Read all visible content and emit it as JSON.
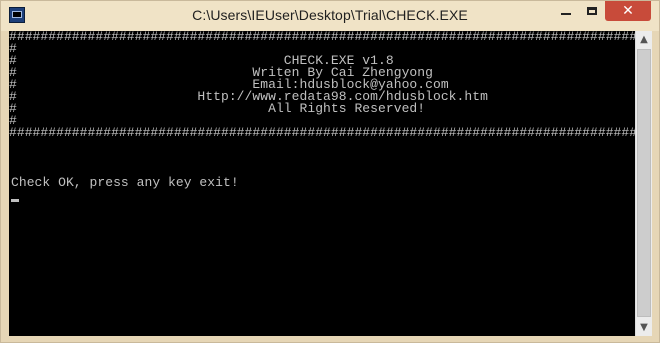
{
  "window": {
    "title": "C:\\Users\\IEUser\\Desktop\\Trial\\CHECK.EXE",
    "controls": {
      "minimize_icon": "minimize-icon",
      "maximize_icon": "maximize-icon",
      "close_label": "✕"
    }
  },
  "console": {
    "banner_lines": [
      "######################################################################################",
      "#                                                                                    #",
      "#                                  CHECK.EXE v1.8                                    #",
      "#                              Writen By Cai Zhengyong                               #",
      "#                              Email:hdusblock@yahoo.com                             #",
      "#                       Http://www.redata98.com/hdusblock.htm                        #",
      "#                                All Rights Reserved!                                #",
      "#                                                                                    #",
      "######################################################################################"
    ],
    "status_line": "Check OK, press any key exit!"
  },
  "colors": {
    "titlebar_bg": "#f0e3c6",
    "close_btn": "#c84b3a",
    "console_bg": "#000000",
    "console_text": "#c0c0c0"
  }
}
